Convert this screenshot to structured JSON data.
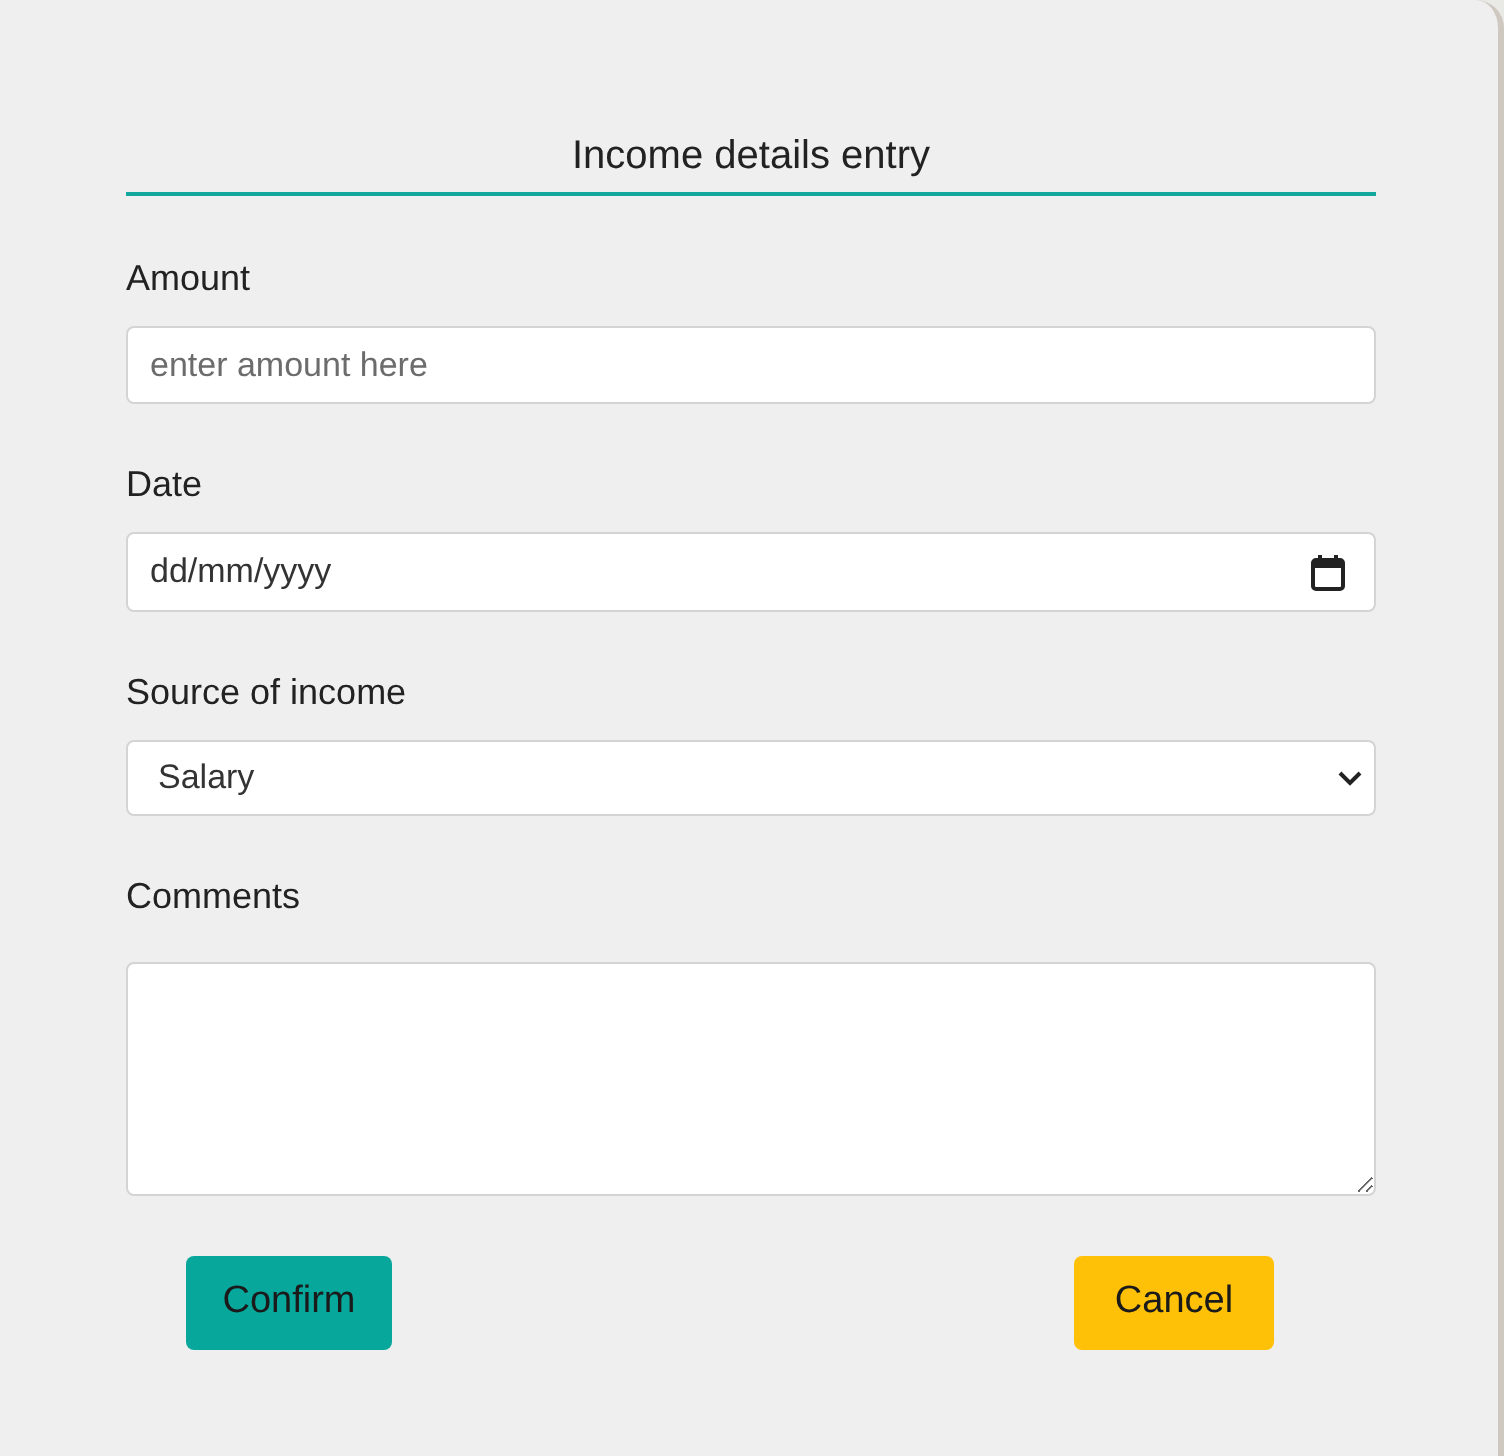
{
  "form": {
    "title": "Income details entry",
    "fields": [
      {
        "kind": "text",
        "label": "Amount",
        "placeholder": "enter amount here"
      },
      {
        "kind": "date",
        "label": "Date",
        "placeholder": "dd/mm/yyyy"
      },
      {
        "kind": "select",
        "label": "Source of income",
        "value": "Salary"
      },
      {
        "kind": "textarea",
        "label": "Comments"
      }
    ],
    "buttons": [
      {
        "kind": "confirm",
        "label": "Confirm"
      },
      {
        "kind": "cancel",
        "label": "Cancel"
      }
    ]
  }
}
